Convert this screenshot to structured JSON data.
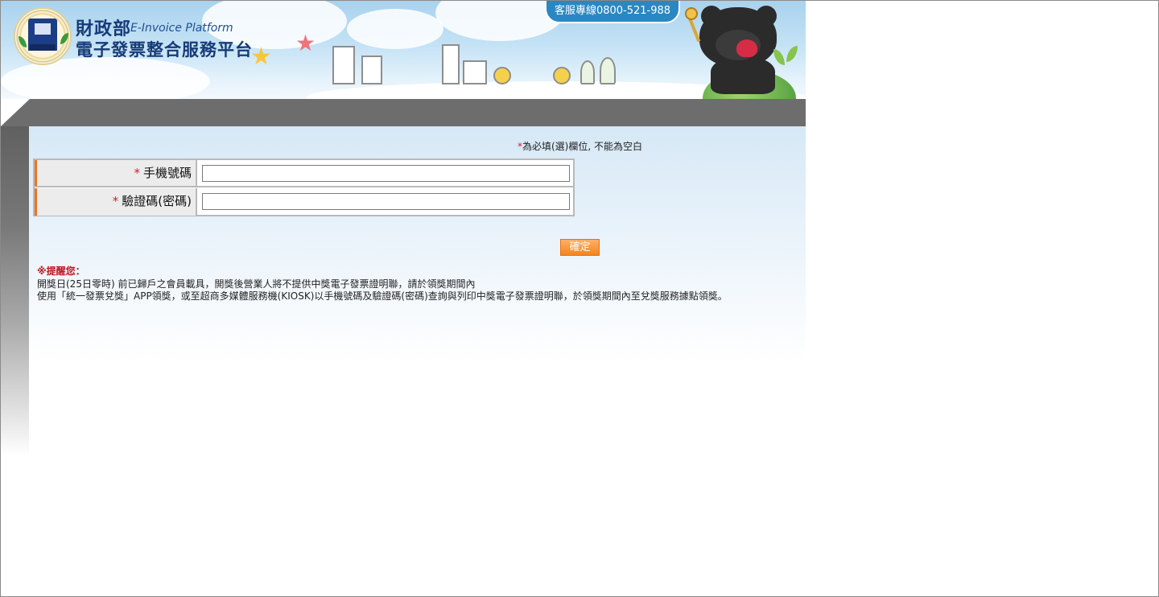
{
  "header": {
    "agency_name": "財政部",
    "platform_en": "E-Invoice Platform",
    "platform_ch": "電子發票整合服務平台",
    "hotline": "客服專線0800-521-988"
  },
  "form": {
    "required_note_mark": "*",
    "required_note_text": "為必填(選)欄位, 不能為空白",
    "fields": [
      {
        "required_mark": "*",
        "label": "手機號碼",
        "value": ""
      },
      {
        "required_mark": "*",
        "label": "驗證碼(密碼)",
        "value": ""
      }
    ],
    "confirm_label": "確定"
  },
  "reminder": {
    "title": "※提醒您：",
    "lines": [
      "開獎日(25日零時) 前已歸戶之會員載具，開獎後營業人將不提供中獎電子發票證明聯，請於領獎期間內",
      "使用「統一發票兌獎」APP領獎，或至超商多媒體服務機(KIOSK)以手機號碼及驗證碼(密碼)查詢與列印中獎電子發票證明聯，於領獎期間內至兌獎服務據點領獎。"
    ]
  },
  "colors": {
    "accent_orange": "#f4841f",
    "required_red": "#d2202f",
    "band_gray": "#6d6d6d",
    "title_blue": "#163b78"
  }
}
